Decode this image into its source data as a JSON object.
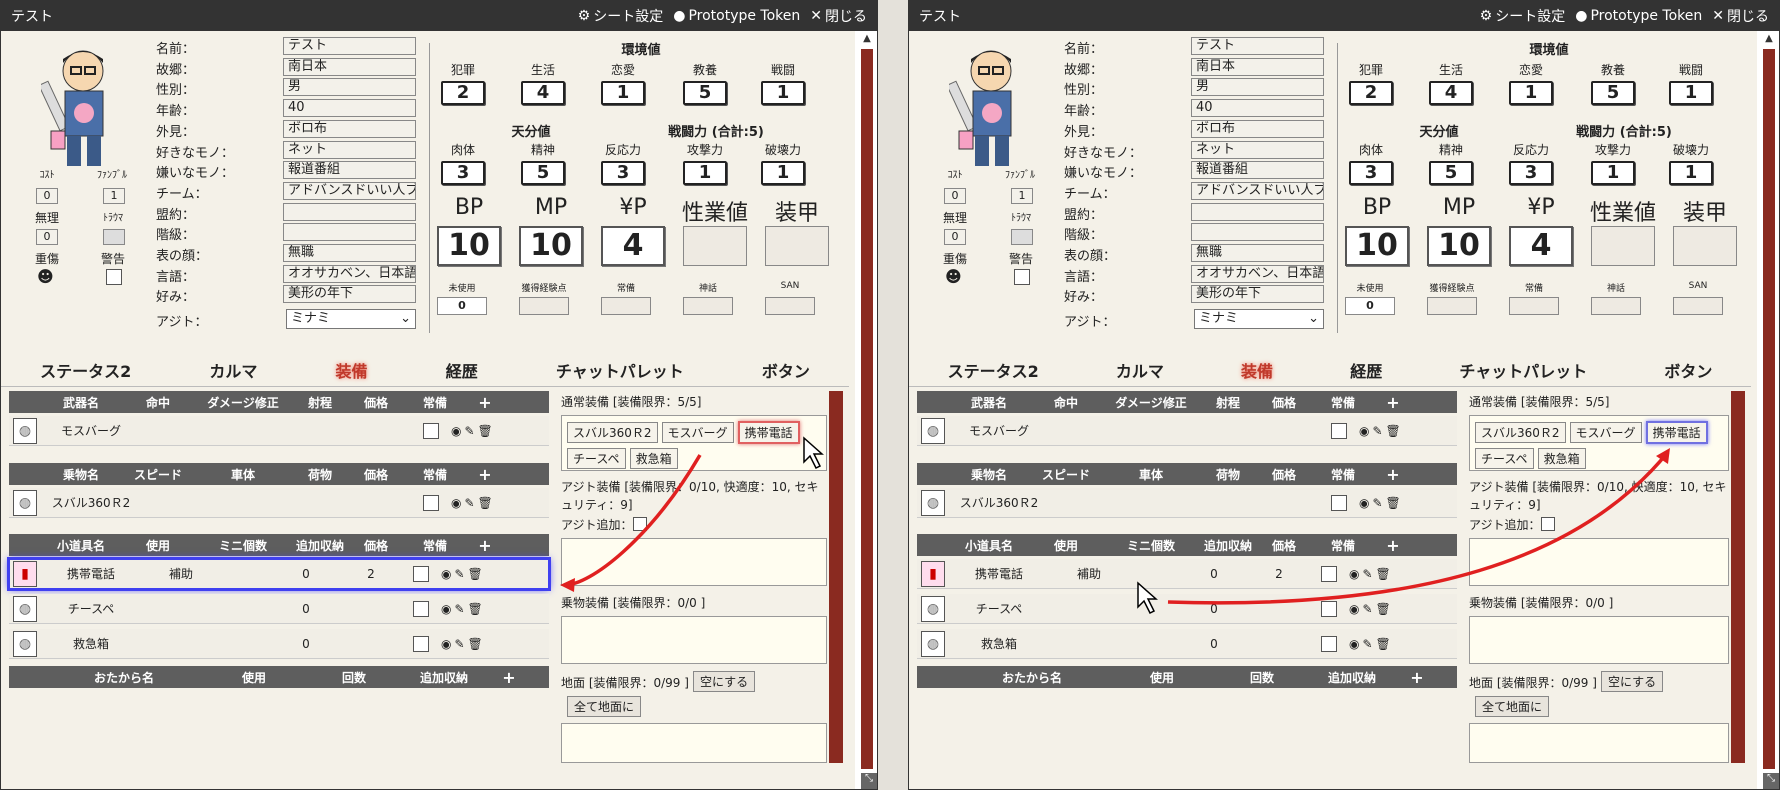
{
  "left": {
    "title": "テスト",
    "sheet_settings": "シート設定",
    "prototype_token": "Prototype Token",
    "close": "閉じる",
    "fields": [
      {
        "label": "名前：",
        "value": "テスト"
      },
      {
        "label": "故郷：",
        "value": "南日本"
      },
      {
        "label": "性別：",
        "value": "男"
      },
      {
        "label": "年齢：",
        "value": "40"
      },
      {
        "label": "外見：",
        "value": "ボロ布"
      },
      {
        "label": "好きなモノ：",
        "value": "ネット"
      },
      {
        "label": "嫌いなモノ：",
        "value": "報道番組"
      },
      {
        "label": "チーム：",
        "value": "アドバンスドいい人ブ"
      },
      {
        "label": "盟約：",
        "value": ""
      },
      {
        "label": "階級：",
        "value": ""
      },
      {
        "label": "表の顔：",
        "value": "無職"
      },
      {
        "label": "言語：",
        "value": "オオサカベン、日本語"
      },
      {
        "label": "好み：",
        "value": "美形の年下"
      }
    ],
    "ajito_label": "アジト：",
    "ajito_value": "ミナミ",
    "cost_label": "ｺｽﾄ",
    "cost": "0",
    "fumble_label": "ﾌｧﾝﾌﾞﾙ",
    "fumble": "1",
    "muri_label": "無理",
    "muri": "0",
    "trauma_label": "ﾄﾗｳﾏ",
    "jusho_label": "重傷",
    "jusho_icon": "☻",
    "keikoku_label": "警告",
    "env_title": "環境値",
    "env": [
      {
        "label": "犯罪",
        "value": "2"
      },
      {
        "label": "生活",
        "value": "4"
      },
      {
        "label": "恋愛",
        "value": "1"
      },
      {
        "label": "教養",
        "value": "5"
      },
      {
        "label": "戦闘",
        "value": "1"
      }
    ],
    "innate_title": "天分値",
    "combat_title": "戦闘力 (合計:5)",
    "innate": [
      {
        "label": "肉体",
        "value": "3"
      },
      {
        "label": "精神",
        "value": "5"
      },
      {
        "label": "反応力",
        "value": "3"
      },
      {
        "label": "攻撃力",
        "value": "1"
      },
      {
        "label": "破壊力",
        "value": "1"
      }
    ],
    "big": [
      {
        "label": "BP",
        "value": "10"
      },
      {
        "label": "MP",
        "value": "10"
      },
      {
        "label": "¥P",
        "value": "4"
      },
      {
        "label": "性業値",
        "value": ""
      },
      {
        "label": "装甲",
        "value": ""
      }
    ],
    "small": [
      {
        "label": "未使用",
        "value": "0"
      },
      {
        "label": "獲得経験点",
        "value": ""
      },
      {
        "label": "常備",
        "value": ""
      },
      {
        "label": "神話",
        "value": ""
      },
      {
        "label": "SAN",
        "value": ""
      }
    ],
    "tabs": [
      "ステータス2",
      "カルマ",
      "装備",
      "経歴",
      "チャットパレット",
      "ボタン"
    ],
    "weapon_hdr": [
      "武器名",
      "命中",
      "ダメージ修正",
      "射程",
      "価格",
      "常備"
    ],
    "weapon_rows": [
      {
        "name": "モスバーグ"
      }
    ],
    "vehicle_hdr": [
      "乗物名",
      "スピード",
      "車体",
      "荷物",
      "価格",
      "常備"
    ],
    "vehicle_rows": [
      {
        "name": "スバル360Ｒ2"
      }
    ],
    "item_hdr": [
      "小道具名",
      "使用",
      "ミニ個数",
      "追加収納",
      "価格",
      "常備"
    ],
    "item_rows": [
      {
        "name": "携帯電話",
        "use": "補助",
        "extra": "0",
        "price": "2"
      },
      {
        "name": "チースペ",
        "use": "",
        "extra": "0",
        "price": ""
      },
      {
        "name": "救急箱",
        "use": "",
        "extra": "0",
        "price": ""
      }
    ],
    "treasure_hdr": [
      "おたから名",
      "使用",
      "回数",
      "追加収納"
    ],
    "normal_eq": "通常装備 [装備限界：5/5]",
    "chips": [
      "スバル360Ｒ2",
      "モスバーグ",
      "携帯電話",
      "チースペ",
      "救急箱"
    ],
    "ajito_eq": "アジト装備 [装備限界：0/10, 快適度：10, セキュリティ：9]",
    "ajito_add": "アジト追加：",
    "vehicle_eq": "乗物装備 [装備限界：0/0 ]",
    "ground_eq": "地面 [装備限界：0/99 ]",
    "empty_btn": "空にする",
    "all_ground_btn": "全て地面に"
  },
  "right": {
    "title": "テスト",
    "sheet_settings": "シート設定",
    "prototype_token": "Prototype Token",
    "close": "閉じる",
    "fields": [
      {
        "label": "名前：",
        "value": "テスト"
      },
      {
        "label": "故郷：",
        "value": "南日本"
      },
      {
        "label": "性別：",
        "value": "男"
      },
      {
        "label": "年齢：",
        "value": "40"
      },
      {
        "label": "外見：",
        "value": "ボロ布"
      },
      {
        "label": "好きなモノ：",
        "value": "ネット"
      },
      {
        "label": "嫌いなモノ：",
        "value": "報道番組"
      },
      {
        "label": "チーム：",
        "value": "アドバンスドいい人ブ"
      },
      {
        "label": "盟約：",
        "value": ""
      },
      {
        "label": "階級：",
        "value": ""
      },
      {
        "label": "表の顔：",
        "value": "無職"
      },
      {
        "label": "言語：",
        "value": "オオサカベン、日本語"
      },
      {
        "label": "好み：",
        "value": "美形の年下"
      }
    ],
    "ajito_label": "アジト：",
    "ajito_value": "ミナミ",
    "cost_label": "ｺｽﾄ",
    "cost": "0",
    "fumble_label": "ﾌｧﾝﾌﾞﾙ",
    "fumble": "1",
    "muri_label": "無理",
    "muri": "0",
    "trauma_label": "ﾄﾗｳﾏ",
    "jusho_label": "重傷",
    "jusho_icon": "☻",
    "keikoku_label": "警告",
    "env_title": "環境値",
    "env": [
      {
        "label": "犯罪",
        "value": "2"
      },
      {
        "label": "生活",
        "value": "4"
      },
      {
        "label": "恋愛",
        "value": "1"
      },
      {
        "label": "教養",
        "value": "5"
      },
      {
        "label": "戦闘",
        "value": "1"
      }
    ],
    "innate_title": "天分値",
    "combat_title": "戦闘力 (合計:5)",
    "innate": [
      {
        "label": "肉体",
        "value": "3"
      },
      {
        "label": "精神",
        "value": "5"
      },
      {
        "label": "反応力",
        "value": "3"
      },
      {
        "label": "攻撃力",
        "value": "1"
      },
      {
        "label": "破壊力",
        "value": "1"
      }
    ],
    "big": [
      {
        "label": "BP",
        "value": "10"
      },
      {
        "label": "MP",
        "value": "10"
      },
      {
        "label": "¥P",
        "value": "4"
      },
      {
        "label": "性業値",
        "value": ""
      },
      {
        "label": "装甲",
        "value": ""
      }
    ],
    "small": [
      {
        "label": "未使用",
        "value": "0"
      },
      {
        "label": "獲得経験点",
        "value": ""
      },
      {
        "label": "常備",
        "value": ""
      },
      {
        "label": "神話",
        "value": ""
      },
      {
        "label": "SAN",
        "value": ""
      }
    ],
    "tabs": [
      "ステータス2",
      "カルマ",
      "装備",
      "経歴",
      "チャットパレット",
      "ボタン"
    ],
    "weapon_hdr": [
      "武器名",
      "命中",
      "ダメージ修正",
      "射程",
      "価格",
      "常備"
    ],
    "weapon_rows": [
      {
        "name": "モスバーグ"
      }
    ],
    "vehicle_hdr": [
      "乗物名",
      "スピード",
      "車体",
      "荷物",
      "価格",
      "常備"
    ],
    "vehicle_rows": [
      {
        "name": "スバル360Ｒ2"
      }
    ],
    "item_hdr": [
      "小道具名",
      "使用",
      "ミニ個数",
      "追加収納",
      "価格",
      "常備"
    ],
    "item_rows": [
      {
        "name": "携帯電話",
        "use": "補助",
        "extra": "0",
        "price": "2"
      },
      {
        "name": "チースペ",
        "use": "",
        "extra": "0",
        "price": ""
      },
      {
        "name": "救急箱",
        "use": "",
        "extra": "0",
        "price": ""
      }
    ],
    "treasure_hdr": [
      "おたから名",
      "使用",
      "回数",
      "追加収納"
    ],
    "normal_eq": "通常装備 [装備限界：5/5]",
    "chips": [
      "スバル360Ｒ2",
      "モスバーグ",
      "携帯電話",
      "チースペ",
      "救急箱"
    ],
    "ajito_eq": "アジト装備 [装備限界：0/10, 快適度：10, セキュリティ：9]",
    "ajito_add": "アジト追加：",
    "vehicle_eq": "乗物装備 [装備限界：0/0 ]",
    "ground_eq": "地面 [装備限界：0/99 ]",
    "empty_btn": "空にする",
    "all_ground_btn": "全て地面に"
  },
  "colors": {
    "accent_tab": "#c0392b",
    "header_bg": "#5e5e5e",
    "titlebar": "#333333",
    "scroll_track": "#8a2a20",
    "arrow": "#e02020",
    "select_outline": "#4040f0"
  }
}
